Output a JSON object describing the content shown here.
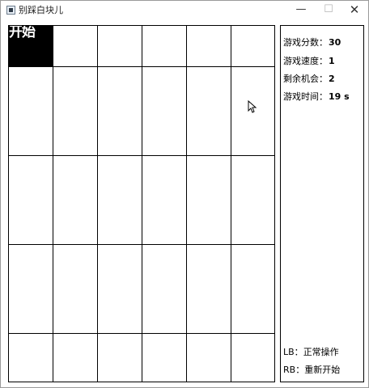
{
  "window": {
    "title": "别踩白块儿",
    "buttons": {
      "minimize": "—",
      "maximize": "☐",
      "close": "✕"
    }
  },
  "board": {
    "start_label": "开始",
    "columns": 6,
    "rows_visible": 5
  },
  "stats": [
    {
      "label": "游戏分数：",
      "value": "30"
    },
    {
      "label": "游戏速度：",
      "value": "1"
    },
    {
      "label": "剩余机会：",
      "value": "2"
    },
    {
      "label": "游戏时间：",
      "value": "19 s"
    }
  ],
  "controls": [
    {
      "key": "LB：",
      "action": "正常操作"
    },
    {
      "key": "RB：",
      "action": "重新开始"
    }
  ]
}
